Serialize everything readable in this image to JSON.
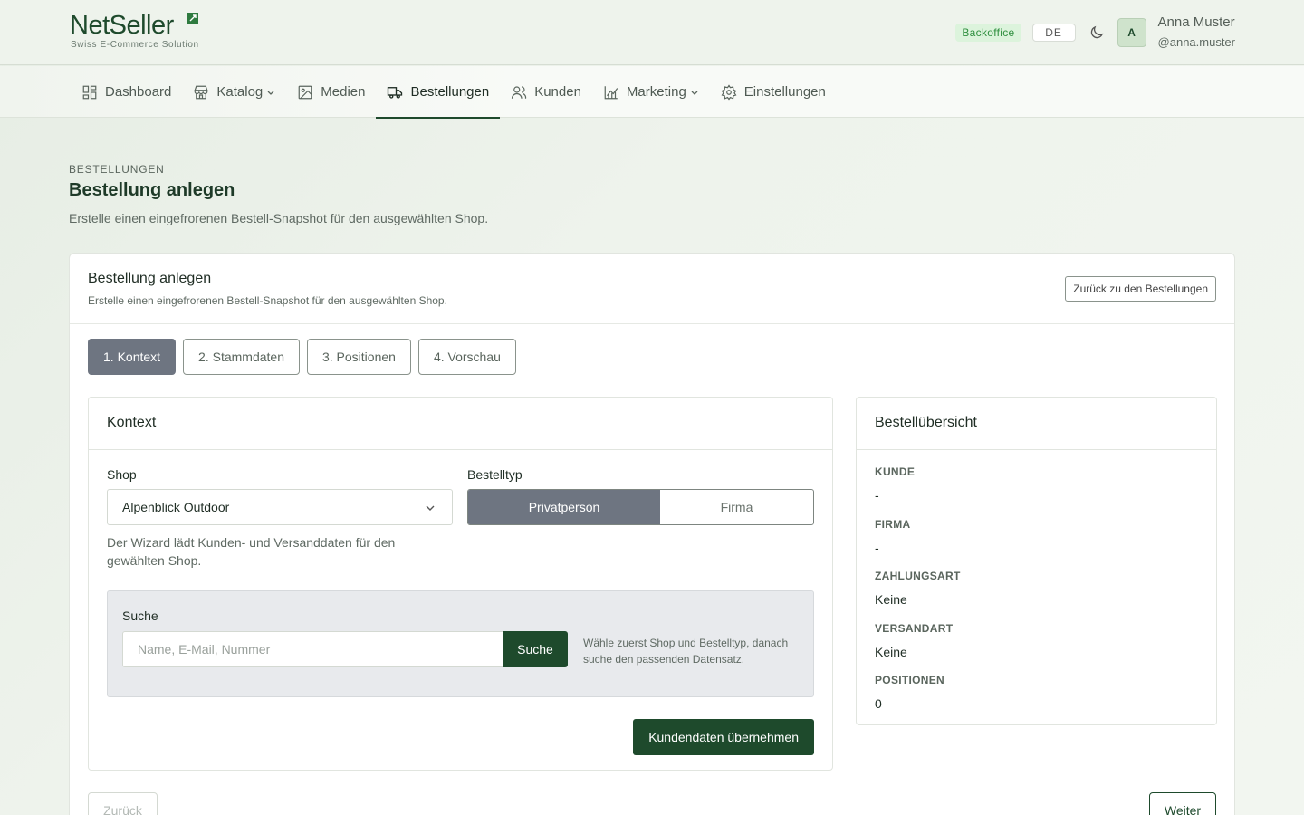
{
  "brand": {
    "name": "NetSeller",
    "tagline": "Swiss E-Commerce Solution"
  },
  "header": {
    "badge": "Backoffice",
    "language": "DE",
    "avatar_initial": "A",
    "user_name": "Anna Muster",
    "user_handle": "@anna.muster"
  },
  "nav": {
    "items": [
      {
        "label": "Dashboard",
        "icon": "dashboard-icon"
      },
      {
        "label": "Katalog",
        "icon": "store-icon",
        "dropdown": true
      },
      {
        "label": "Medien",
        "icon": "image-icon"
      },
      {
        "label": "Bestellungen",
        "icon": "truck-icon",
        "active": true
      },
      {
        "label": "Kunden",
        "icon": "users-icon"
      },
      {
        "label": "Marketing",
        "icon": "chart-icon",
        "dropdown": true
      },
      {
        "label": "Einstellungen",
        "icon": "gear-icon"
      }
    ]
  },
  "page": {
    "breadcrumb": "BESTELLUNGEN",
    "title": "Bestellung anlegen",
    "description": "Erstelle einen eingefrorenen Bestell-Snapshot für den ausgewählten Shop."
  },
  "card": {
    "title": "Bestellung anlegen",
    "subtitle": "Erstelle einen eingefrorenen Bestell-Snapshot für den ausgewählten Shop.",
    "back_label": "Zurück zu den Bestellungen"
  },
  "steps": [
    "1. Kontext",
    "2. Stammdaten",
    "3. Positionen",
    "4. Vorschau"
  ],
  "context": {
    "title": "Kontext",
    "shop_label": "Shop",
    "shop_value": "Alpenblick Outdoor",
    "shop_help": "Der Wizard lädt Kunden- und Versanddaten für den gewählten Shop.",
    "type_label": "Bestelltyp",
    "type_options": [
      "Privatperson",
      "Firma"
    ],
    "search_label": "Suche",
    "search_placeholder": "Name, E-Mail, Nummer",
    "search_button": "Suche",
    "search_hint": "Wähle zuerst Shop und Bestelltyp, danach suche den passenden Datensatz.",
    "apply_button": "Kundendaten übernehmen"
  },
  "summary": {
    "title": "Bestellübersicht",
    "rows": [
      {
        "key": "KUNDE",
        "value": "-"
      },
      {
        "key": "FIRMA",
        "value": "-"
      },
      {
        "key": "ZAHLUNGSART",
        "value": "Keine"
      },
      {
        "key": "VERSANDART",
        "value": "Keine"
      },
      {
        "key": "POSITIONEN",
        "value": "0"
      }
    ]
  },
  "footer": {
    "prev_label": "Zurück",
    "next_label": "Weiter"
  },
  "colors": {
    "brand": "#1e4a2c",
    "active_step": "#6e7581",
    "badge_bg": "#dcf3dc",
    "badge_text": "#2f8f3f"
  }
}
